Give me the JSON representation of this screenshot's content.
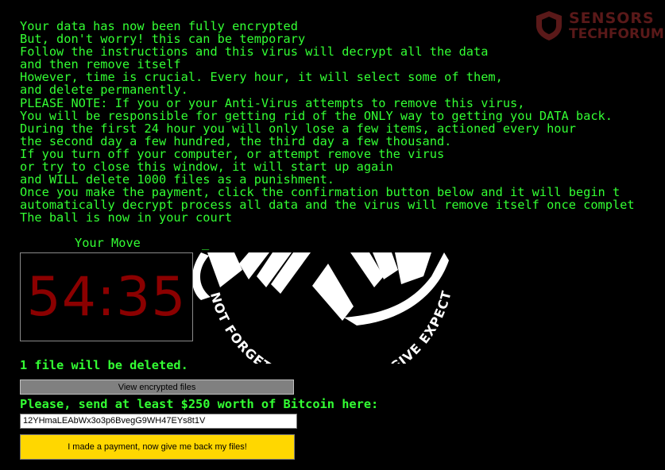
{
  "message_lines": [
    "Your data has now been fully encrypted",
    "But, don't worry! this can be temporary",
    "Follow the instructions and this virus will decrypt all the data",
    "and then remove itself",
    "However, time is crucial. Every hour, it will select some of them,",
    "and delete permanently.",
    "PLEASE NOTE: If you or your Anti-Virus attempts to remove this virus,",
    "You will be responsible for getting rid of the ONLY way to getting you DATA back.",
    "During the first 24 hour you will only lose a few items, actioned every hour",
    "the second day a few hundred, the third day a few thousand.",
    "If you turn off your computer, or attempt remove the virus",
    "or try to close this window, it will start up again",
    "and WILL delete 1000 files as a punishment.",
    "Once you make the payment, click the confirmation button below and it will begin t",
    "automatically decrypt process all data and the virus will remove itself once complet",
    "The ball is now in your court"
  ],
  "watermark": {
    "line1": "SENSORS",
    "line2": "TECHFORUM",
    "color": "#5a1919",
    "icon": "shield-icon"
  },
  "timer": {
    "label": "Your Move",
    "cursor": "_",
    "value": "54:35",
    "color": "#8b0000"
  },
  "emblem": {
    "text": "NOT FORGET WE DO NOT FORGIVE EXPECT",
    "icon": "anonymous-emblem-icon"
  },
  "status": {
    "deleted_text": "1 file will be deleted."
  },
  "buttons": {
    "view_files": "View encrypted files",
    "confirm_payment": "I made a payment, now give me back my files!"
  },
  "payment": {
    "prompt": "Please, send at least $250 worth of Bitcoin here:",
    "wallet_address": "12YHmaLEAbWx3o3p6BvegG9WH47EYs8t1V"
  },
  "colors": {
    "background": "#000000",
    "text": "#33ff33",
    "confirm_button": "#ffd700",
    "view_button": "#808080"
  }
}
